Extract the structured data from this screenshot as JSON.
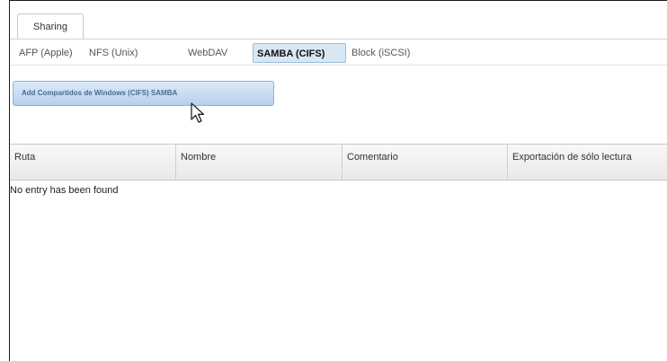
{
  "main_tabs": [
    {
      "label": "Sharing",
      "active": true
    }
  ],
  "sub_tabs": [
    {
      "label": "AFP (Apple)",
      "active": false
    },
    {
      "label": "NFS (Unix)",
      "active": false
    },
    {
      "label": "WebDAV",
      "active": false
    },
    {
      "label": "SAMBA (CIFS)",
      "active": true
    },
    {
      "label": "Block (iSCSI)",
      "active": false
    }
  ],
  "toolbar": {
    "add_label": "Add Compartidos de Windows (CIFS) SAMBA"
  },
  "grid": {
    "columns": [
      "Ruta",
      "Nombre",
      "Comentario",
      "Exportación de sólo lectura"
    ],
    "empty_message": "No entry has been found"
  },
  "colors": {
    "active_tab_bg": "#d9e7f5",
    "button_accent": "#b7d0ec"
  },
  "icons": {
    "cursor": "mouse-pointer-icon"
  }
}
